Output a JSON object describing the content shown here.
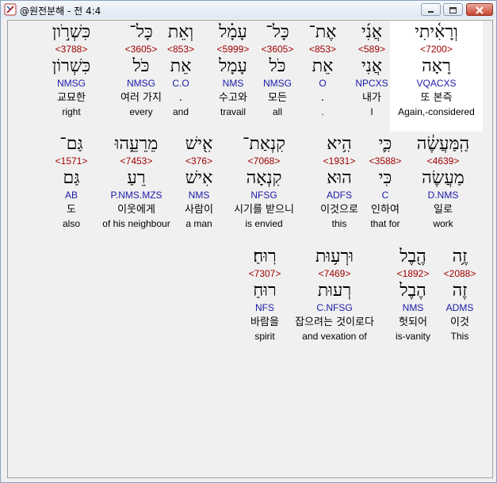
{
  "window": {
    "title": "@원전분해 - 전 4:4"
  },
  "rows": [
    [
      {
        "heb": "וְרָאִ֫יתִי",
        "strong": "<7200>",
        "lemma": "רָאָה",
        "morph": "VQACXS",
        "kor": "또 본즉",
        "eng": "Again,-considered",
        "highlight": true
      },
      {
        "heb": "אֲנִ֜י",
        "strong": "<589>",
        "lemma": "אֲנִי",
        "morph": "NPCXS",
        "kor": "내가",
        "eng": "I"
      },
      {
        "heb": "אֶת־",
        "strong": "<853>",
        "lemma": "אֵת",
        "morph": "O",
        "kor": ".",
        "eng": "."
      },
      {
        "heb": "כָּל־",
        "strong": "<3605>",
        "lemma": "כֹּל",
        "morph": "NMSG",
        "kor": "모든",
        "eng": "all"
      },
      {
        "heb": "עָמָ֗ל",
        "strong": "<5999>",
        "lemma": "עָמָל",
        "morph": "NMS",
        "kor": "수고와",
        "eng": "travail"
      },
      {
        "heb": "וְאֵת",
        "strong": "<853>",
        "lemma": "אֵת",
        "morph": "C.O",
        "kor": ".",
        "eng": "and"
      },
      {
        "heb": "כָּל־",
        "strong": "<3605>",
        "lemma": "כֹּל",
        "morph": "NMSG",
        "kor": "여러 가지",
        "eng": "every"
      },
      {
        "heb": "כִּשְׁרֹ֣ון",
        "strong": "<3788>",
        "lemma": "כִּשְׁרוֹן",
        "morph": "NMSG",
        "kor": "교묘한",
        "eng": "right"
      }
    ],
    [
      {
        "heb": "הַֽמַּעֲשֶׂ֔ה",
        "strong": "<4639>",
        "lemma": "מַעֲשֶׂה",
        "morph": "D.NMS",
        "kor": "일로",
        "eng": "work"
      },
      {
        "heb": "כִּ֛י",
        "strong": "<3588>",
        "lemma": "כִּי",
        "morph": "C",
        "kor": "인하여",
        "eng": "that for"
      },
      {
        "heb": "הִ֥יא",
        "strong": "<1931>",
        "lemma": "הוּא",
        "morph": "ADFS",
        "kor": "이것으로",
        "eng": "this"
      },
      {
        "heb": "קִנְאַת־",
        "strong": "<7068>",
        "lemma": "קִנְאָה",
        "morph": "NFSG",
        "kor": "시기를 받으니",
        "eng": "is envied"
      },
      {
        "heb": "אִ֖ישׁ",
        "strong": "<376>",
        "lemma": "אִישׁ",
        "morph": "NMS",
        "kor": "사람이",
        "eng": "a man"
      },
      {
        "heb": "מֵרֵעֵ֑הוּ",
        "strong": "<7453>",
        "lemma": "רֵעַ",
        "morph": "P.NMS.MZS",
        "kor": "이웃에게",
        "eng": "of his neighbour"
      },
      {
        "heb": "גַּם־",
        "strong": "<1571>",
        "lemma": "גַּם",
        "morph": "AB",
        "kor": "도",
        "eng": "also"
      }
    ],
    [
      {
        "heb": "זֶ֥ה",
        "strong": "<2088>",
        "lemma": "זֶה",
        "morph": "ADMS",
        "kor": "이것",
        "eng": "This"
      },
      {
        "heb": "הֶ֖בֶל",
        "strong": "<1892>",
        "lemma": "הֶבֶל",
        "morph": "NMS",
        "kor": "헛되어",
        "eng": "is-vanity"
      },
      {
        "heb": "וּרְע֥וּת",
        "strong": "<7469>",
        "lemma": "רְעוּת",
        "morph": "C.NFSG",
        "kor": "잡으려는 것이로다",
        "eng": "and vexation of"
      },
      {
        "heb": "רֽוּחַ׃",
        "strong": "<7307>",
        "lemma": "רוּחַ",
        "morph": "NFS",
        "kor": "바람을",
        "eng": "spirit"
      }
    ]
  ]
}
